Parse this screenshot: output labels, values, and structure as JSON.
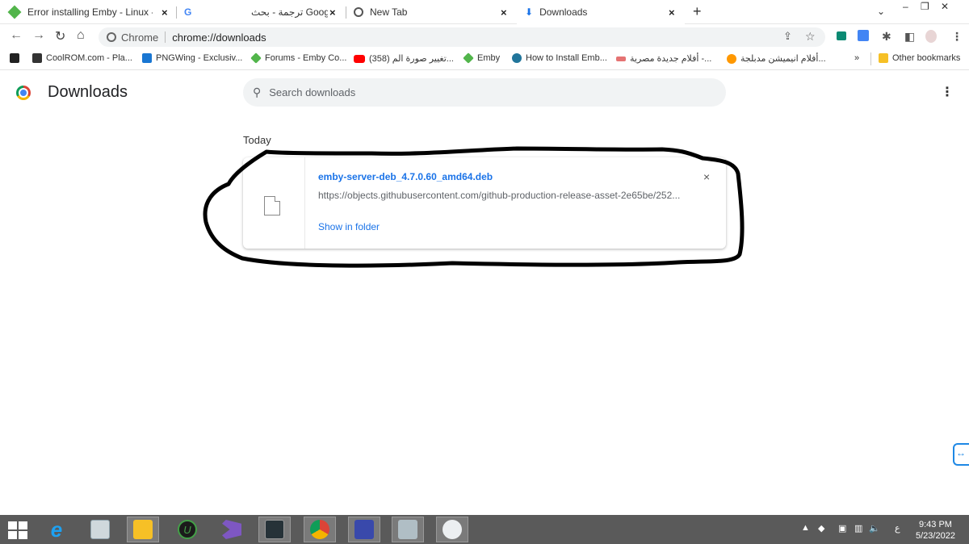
{
  "tabs": [
    {
      "title": "Error installing Emby - Linux - Em",
      "close": "×"
    },
    {
      "title": "ترجمة - بحث Google",
      "close": "×"
    },
    {
      "title": "New Tab",
      "close": "×"
    },
    {
      "title": "Downloads",
      "close": "×"
    }
  ],
  "new_tab": "+",
  "address": {
    "chip": "Chrome",
    "url": "chrome://downloads"
  },
  "bookmarks": [
    {
      "label": "CoolROM.com - Pla...",
      "color": "#333333"
    },
    {
      "label": "PNGWing - Exclusiv...",
      "color": "#1976d2"
    },
    {
      "label": "Forums - Emby Co...",
      "color": "#52b54b"
    },
    {
      "label": "(358) تغيير صورة الم...",
      "color": "#ff0000"
    },
    {
      "label": "Emby",
      "color": "#52b54b"
    },
    {
      "label": "How to Install Emb...",
      "color": "#21759b"
    },
    {
      "label": "أفلام جديدة مصرية -...",
      "color": "#e57373"
    },
    {
      "label": "أفلام انيميشن مدبلجة...",
      "color": "#ff9800"
    }
  ],
  "bookmarks_more": "»",
  "other_bookmarks": "Other bookmarks",
  "page": {
    "title": "Downloads",
    "search_placeholder": "Search downloads",
    "section": "Today"
  },
  "download": {
    "file_name": "emby-server-deb_4.7.0.60_amd64.deb",
    "url": "https://objects.githubusercontent.com/github-production-release-asset-2e65be/252...",
    "action": "Show in folder",
    "close": "×"
  },
  "taskbar": {
    "time": "9:43 PM",
    "date": "5/23/2022",
    "lang": "ع"
  },
  "colors": {
    "accent": "#1a73e8",
    "taskbar": "#5a5a5a"
  }
}
